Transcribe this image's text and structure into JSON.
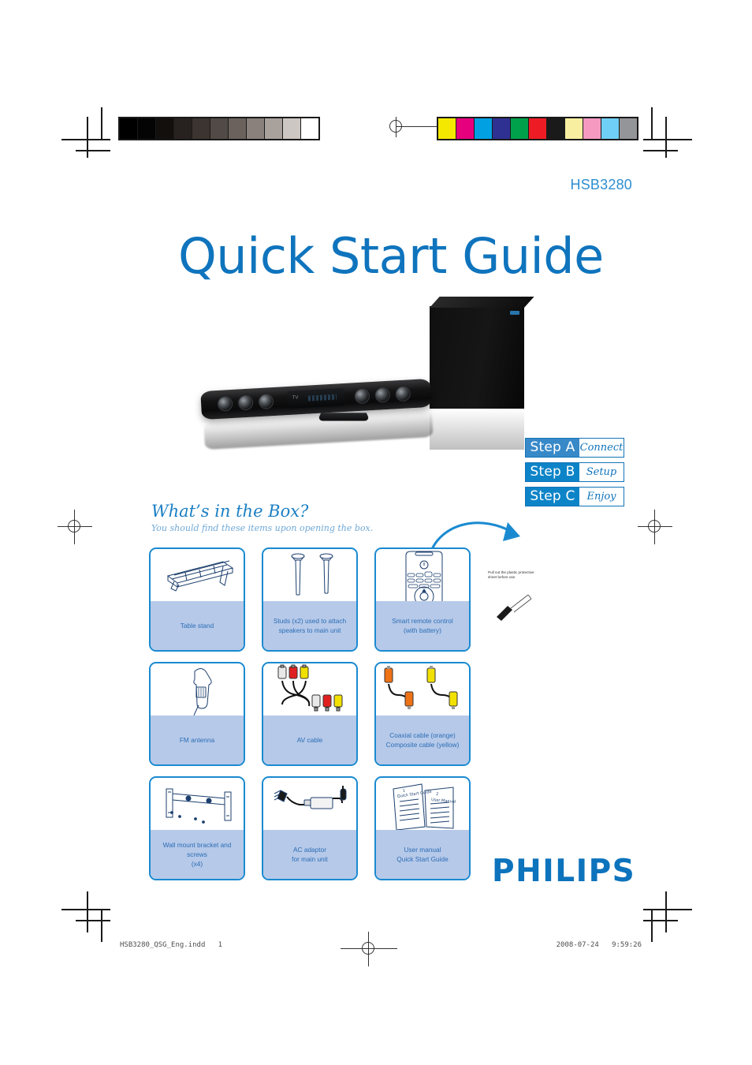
{
  "document": {
    "model": "HSB3280",
    "title": "Quick Start Guide",
    "brand": "PHILIPS"
  },
  "steps": [
    {
      "key": "Step A",
      "value": "Connect",
      "color": "#3889c8"
    },
    {
      "key": "Step B",
      "value": "Setup",
      "color": "#0e84c8"
    },
    {
      "key": "Step C",
      "value": "Enjoy",
      "color": "#0e84c8"
    }
  ],
  "whats_in_the_box": {
    "heading": "What’s in the Box?",
    "subheading": "You should find these items upon opening the box.",
    "items": [
      {
        "icon": "table-stand-icon",
        "label": "Table stand"
      },
      {
        "icon": "studs-icon",
        "label": "Studs (x2) used to attach\nspeakers to main unit"
      },
      {
        "icon": "remote-control-icon",
        "label": "Smart remote control\n(with battery)"
      },
      {
        "icon": "fm-antenna-icon",
        "label": "FM antenna"
      },
      {
        "icon": "av-cable-icon",
        "label": "AV cable"
      },
      {
        "icon": "coaxial-cable-icon",
        "label": "Coaxial cable (orange)\nComposite cable (yellow)"
      },
      {
        "icon": "wall-mount-icon",
        "label": "Wall mount bracket and screws\n(x4)"
      },
      {
        "icon": "ac-adaptor-icon",
        "label": "AC adaptor\nfor main unit"
      },
      {
        "icon": "manuals-icon",
        "label": "User manual\nQuick Start Guide"
      }
    ]
  },
  "callout": {
    "note": "Pull out the plastic protective sheet before use."
  },
  "print_marks": {
    "grayscale_swatches": [
      "#000000",
      "#040404",
      "#120f0d",
      "#272220",
      "#3b3431",
      "#524a46",
      "#6b625d",
      "#8a817c",
      "#a9a19c",
      "#ccc7c3",
      "#ffffff"
    ],
    "color_swatches": [
      "#f5e800",
      "#e6007e",
      "#00a0e3",
      "#2e3192",
      "#00a14b",
      "#ed1c24",
      "#1a1a1a",
      "#f9efa0",
      "#f49ac1",
      "#6fcff6",
      "#939598"
    ]
  },
  "footer": {
    "filename": "HSB3280_QSG_Eng.indd   1",
    "timestamp": "2008-07-24   9:59:26"
  }
}
